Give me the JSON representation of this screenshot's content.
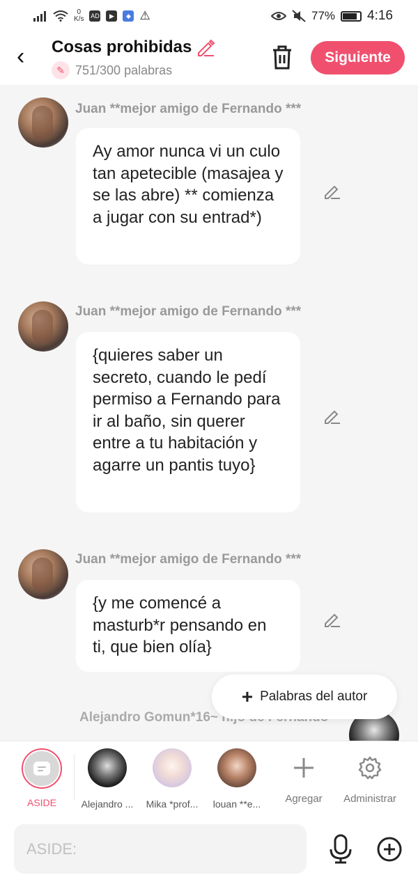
{
  "status_bar": {
    "net_speed_value": "0",
    "net_speed_unit": "K/s",
    "battery": "77%",
    "time": "4:16",
    "icons": [
      "signal-icon",
      "wifi-icon",
      "ad-icon",
      "play-icon",
      "shield-icon",
      "warning-icon",
      "eye-icon",
      "mute-icon",
      "battery-icon"
    ]
  },
  "header": {
    "title": "Cosas prohibidas",
    "word_count": "751/300 palabras",
    "next_label": "Siguiente",
    "accent_color": "#f0506e"
  },
  "messages": [
    {
      "speaker": "Juan **mejor amigo de Fernando ***",
      "text": "Ay amor nunca vi un culo tan apetecible (masajea y se las abre) ** comienza a jugar con su entrad*)"
    },
    {
      "speaker": "Juan **mejor amigo de Fernando ***",
      "text": "{quieres saber un secreto, cuando le pedí permiso a Fernando para ir al baño, sin querer entre a tu habitación y agarre un pantis tuyo}"
    },
    {
      "speaker": "Juan **mejor amigo de Fernando ***",
      "text": "{y me comencé a masturb*r pensando en ti, que bien olía}"
    }
  ],
  "next_speaker_partial": "Alejandro Gomun*16~ hijo de Fernando",
  "author_words_button": "Palabras del autor",
  "characters": [
    {
      "label": "ASIDE"
    },
    {
      "label": "Alejandro ..."
    },
    {
      "label": "Mika *prof..."
    },
    {
      "label": "louan **e..."
    }
  ],
  "tools": {
    "add_label": "Agregar",
    "manage_label": "Administrar"
  },
  "input": {
    "placeholder": "ASIDE:",
    "value": ""
  }
}
